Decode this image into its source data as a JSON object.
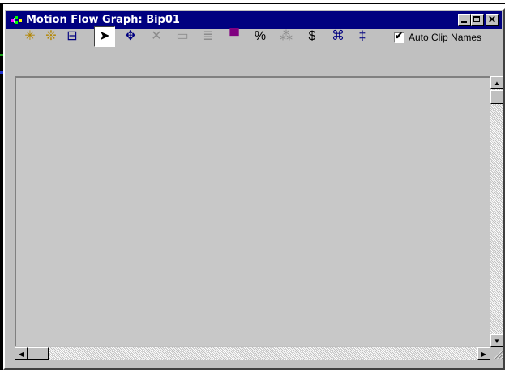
{
  "window": {
    "title": "Motion Flow Graph: Bip01",
    "title_bar_color": "#000080",
    "controls": {
      "minimize_icon": "minimize-icon",
      "maximize_icon": "maximize-icon",
      "close_glyph": "✕"
    }
  },
  "toolbar": {
    "tools": [
      {
        "name": "create-clip-icon",
        "glyph": "✳"
      },
      {
        "name": "create-multiple-clips-icon",
        "glyph": "❊"
      },
      {
        "name": "create-transition-icon",
        "glyph": "⊟"
      },
      {
        "name": "select-icon",
        "glyph": "➤"
      },
      {
        "name": "move-icon",
        "glyph": "✥"
      },
      {
        "name": "delete-icon",
        "glyph": "✕"
      },
      {
        "name": "show-script-icon",
        "glyph": "▭"
      },
      {
        "name": "edit-icon",
        "glyph": "≣"
      },
      {
        "name": "select-random-start-icon",
        "glyph": "▀"
      },
      {
        "name": "percent-icon",
        "glyph": "%"
      },
      {
        "name": "optimize-transitions-icon",
        "glyph": "⁂"
      },
      {
        "name": "dollar-icon",
        "glyph": "$"
      },
      {
        "name": "select-multiple-icon",
        "glyph": "⌘"
      },
      {
        "name": "properties-icon",
        "glyph": "‡"
      }
    ],
    "auto_clip_names": {
      "label": "Auto Clip Names",
      "checked": true,
      "check_glyph": "✔"
    }
  },
  "scrollbars": {
    "up_arrow": "▲",
    "down_arrow": "▼",
    "left_arrow": "◀",
    "right_arrow": "▶"
  },
  "colors": {
    "graph_background": "#c8c8c8",
    "window_face": "#c0c0c0"
  }
}
